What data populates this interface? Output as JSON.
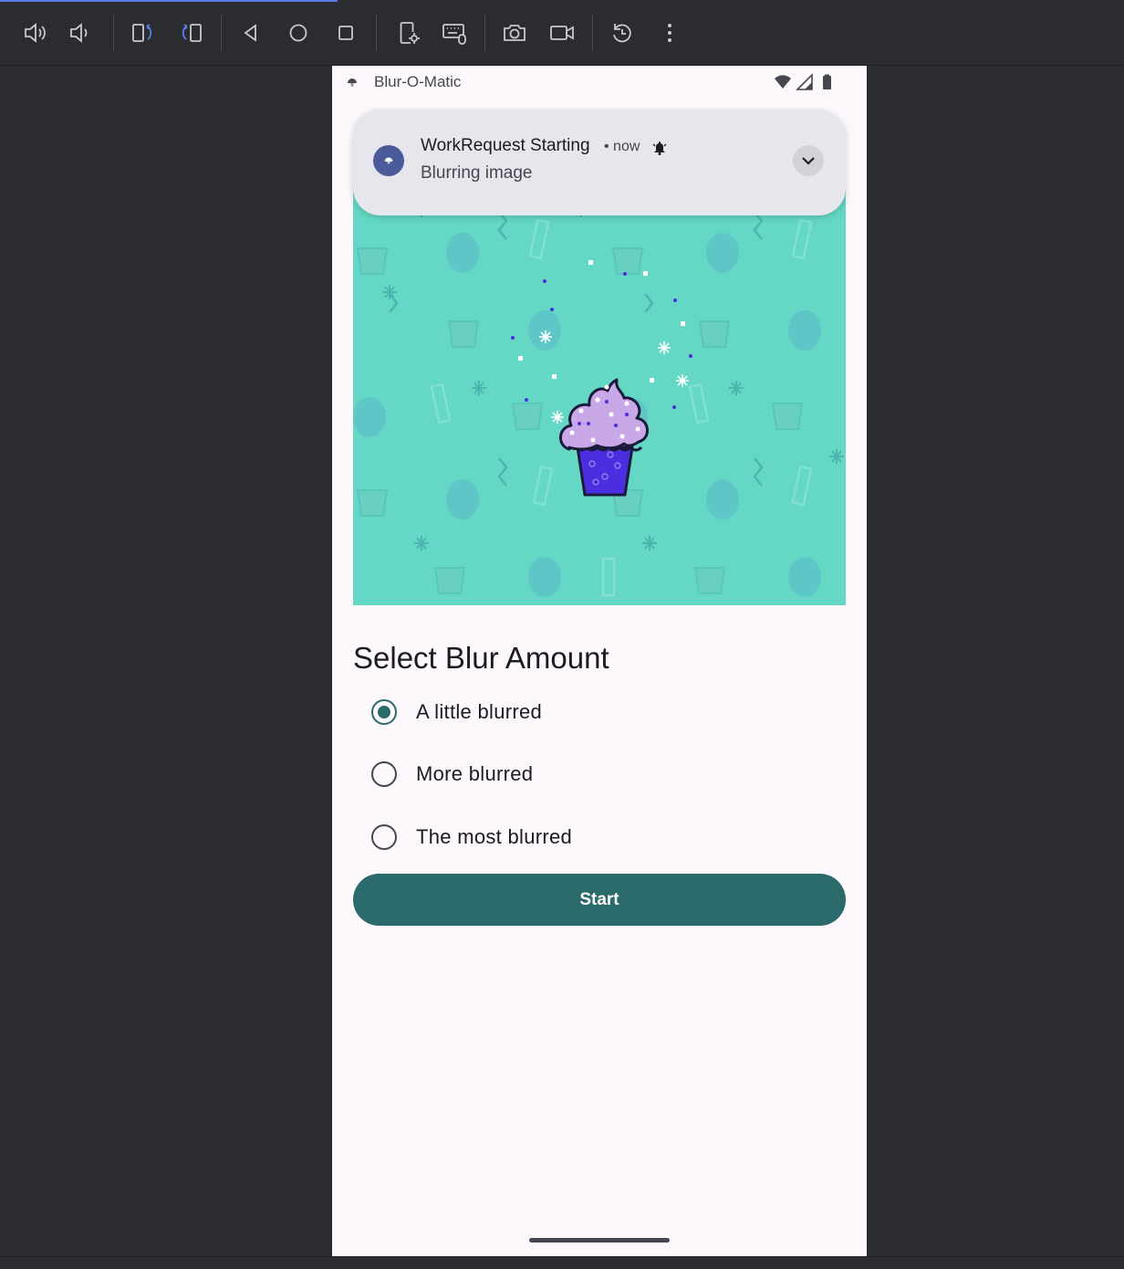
{
  "toolbar": {
    "buttons": [
      {
        "name": "volume-up"
      },
      {
        "name": "volume-down"
      },
      {
        "name": "rotate-left"
      },
      {
        "name": "rotate-right"
      },
      {
        "name": "back"
      },
      {
        "name": "home"
      },
      {
        "name": "overview"
      },
      {
        "name": "device-settings"
      },
      {
        "name": "keyboard-mouse"
      },
      {
        "name": "screenshot"
      },
      {
        "name": "screen-record"
      },
      {
        "name": "reset"
      },
      {
        "name": "more"
      }
    ],
    "accent_color": "#5b7ce8"
  },
  "statusbar": {
    "app_title": "Blur-O-Matic"
  },
  "notification": {
    "title": "WorkRequest Starting",
    "meta": "• now",
    "text": "Blurring image"
  },
  "main": {
    "heading": "Select Blur Amount",
    "options": [
      {
        "label": "A little blurred",
        "checked": true
      },
      {
        "label": "More blurred",
        "checked": false
      },
      {
        "label": "The most blurred",
        "checked": false
      }
    ],
    "start_label": "Start"
  },
  "colors": {
    "primary": "#2b6a6a",
    "image_background": "#64d8c4",
    "screen_background": "#fcf8fc",
    "notification_background": "#e7e6ec"
  }
}
